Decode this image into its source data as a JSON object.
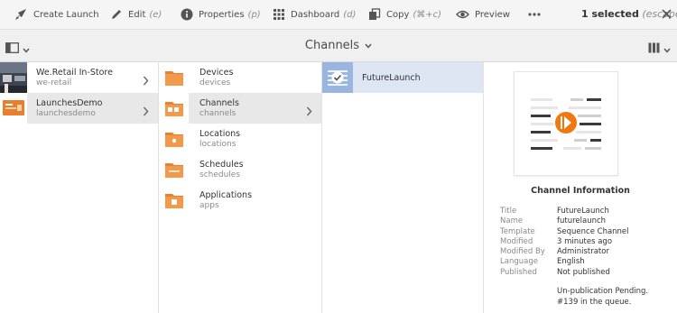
{
  "actionbar": {
    "create_launch": "Create Launch",
    "edit": "Edit",
    "edit_shortcut": "(e)",
    "properties": "Properties",
    "properties_shortcut": "(p)",
    "dashboard": "Dashboard",
    "dashboard_shortcut": "(d)",
    "copy": "Copy",
    "copy_shortcut": "(⌘+c)",
    "preview": "Preview",
    "selected_count": "1 selected",
    "escape_hint": "(escape)"
  },
  "titlebar": {
    "title": "Channels"
  },
  "column1": [
    {
      "name": "We.Retail In-Store",
      "sub": "we-retail",
      "thumb_icon": "photo-thumbnail"
    },
    {
      "name": "LaunchesDemo",
      "sub": "launchesdemo",
      "thumb_icon": "orange-screen-thumbnail"
    }
  ],
  "column2": [
    {
      "name": "Devices",
      "sub": "devices"
    },
    {
      "name": "Channels",
      "sub": "channels"
    },
    {
      "name": "Locations",
      "sub": "locations"
    },
    {
      "name": "Schedules",
      "sub": "schedules"
    },
    {
      "name": "Applications",
      "sub": "apps"
    }
  ],
  "column3": [
    {
      "name": "FutureLaunch"
    }
  ],
  "details": {
    "heading": "Channel Information",
    "properties": [
      {
        "key": "Title",
        "value": "FutureLaunch"
      },
      {
        "key": "Name",
        "value": "futurelaunch"
      },
      {
        "key": "Template",
        "value": "Sequence Channel"
      },
      {
        "key": "Modified",
        "value": "3 minutes ago"
      },
      {
        "key": "Modified By",
        "value": "Administrator"
      },
      {
        "key": "Language",
        "value": "English"
      },
      {
        "key": "Published",
        "value": "Not published"
      }
    ],
    "status_line1": "Un-publication Pending.",
    "status_line2": "#139 in the queue."
  },
  "colors": {
    "accent_orange": "#f0780e",
    "folder_orange": "#e9812e",
    "selected_blue": "#dfe6f3"
  }
}
